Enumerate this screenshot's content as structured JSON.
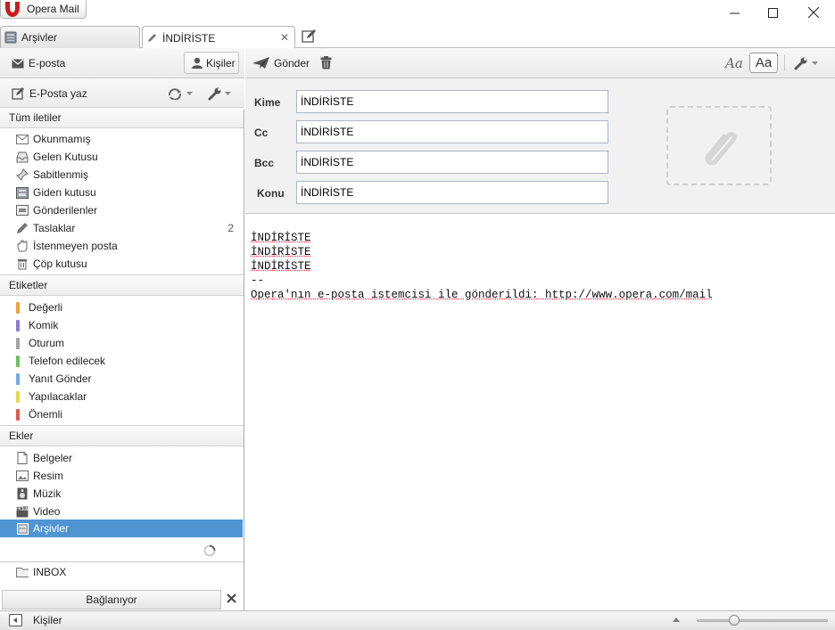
{
  "app": {
    "title": "Opera Mail"
  },
  "tabs": [
    {
      "label": "Arşivler"
    },
    {
      "label": "İNDİRİSTE"
    }
  ],
  "sidebar": {
    "mail_label": "E-posta",
    "contacts_label": "Kişiler",
    "compose_label": "E-Posta yaz",
    "all_messages_header": "Tüm iletiler",
    "mail_items": [
      {
        "label": "Okunmamış"
      },
      {
        "label": "Gelen Kutusu"
      },
      {
        "label": "Sabitlenmiş"
      },
      {
        "label": "Giden kutusu"
      },
      {
        "label": "Gönderilenler"
      },
      {
        "label": "Taslaklar",
        "count": "2"
      },
      {
        "label": "İstenmeyen posta"
      },
      {
        "label": "Çöp kutusu"
      }
    ],
    "labels_header": "Etiketler",
    "label_items": [
      {
        "label": "Değerli",
        "color": "#f2a13a"
      },
      {
        "label": "Komik",
        "color": "#8d7ad6"
      },
      {
        "label": "Oturum",
        "color": "#a4a4a4"
      },
      {
        "label": "Telefon edilecek",
        "color": "#6cc35c"
      },
      {
        "label": "Yanıt Gönder",
        "color": "#72a9e4"
      },
      {
        "label": "Yapılacaklar",
        "color": "#e8d64a"
      },
      {
        "label": "Önemli",
        "color": "#e45a4f"
      }
    ],
    "attachments_header": "Ekler",
    "attachment_items": [
      {
        "label": "Belgeler"
      },
      {
        "label": "Resim"
      },
      {
        "label": "Müzik"
      },
      {
        "label": "Video"
      },
      {
        "label": "Arşivler"
      }
    ],
    "inbox_label": "INBOX",
    "connecting_label": "Bağlanıyor"
  },
  "compose": {
    "send_label": "Gönder",
    "fields": {
      "to_label": "Kime",
      "to_value": "İNDİRİSTE",
      "cc_label": "Cc",
      "cc_value": "İNDİRİSTE",
      "bcc_label": "Bcc",
      "bcc_value": "İNDİRİSTE",
      "subject_label": "Konu",
      "subject_value": "İNDİRİSTE"
    },
    "body_lines": [
      "İNDİRİSTE",
      "İNDİRİSTE",
      "İNDİRİSTE",
      "--",
      "Opera'nın e-posta istemcisi ile gönderildi: http://www.opera.com/mail"
    ]
  },
  "statusbar": {
    "contacts_label": "Kişiler",
    "zoom_fraction": 0.27
  },
  "colors": {
    "selected": "#4f95d3",
    "opera_red": "#cc1a1a"
  }
}
